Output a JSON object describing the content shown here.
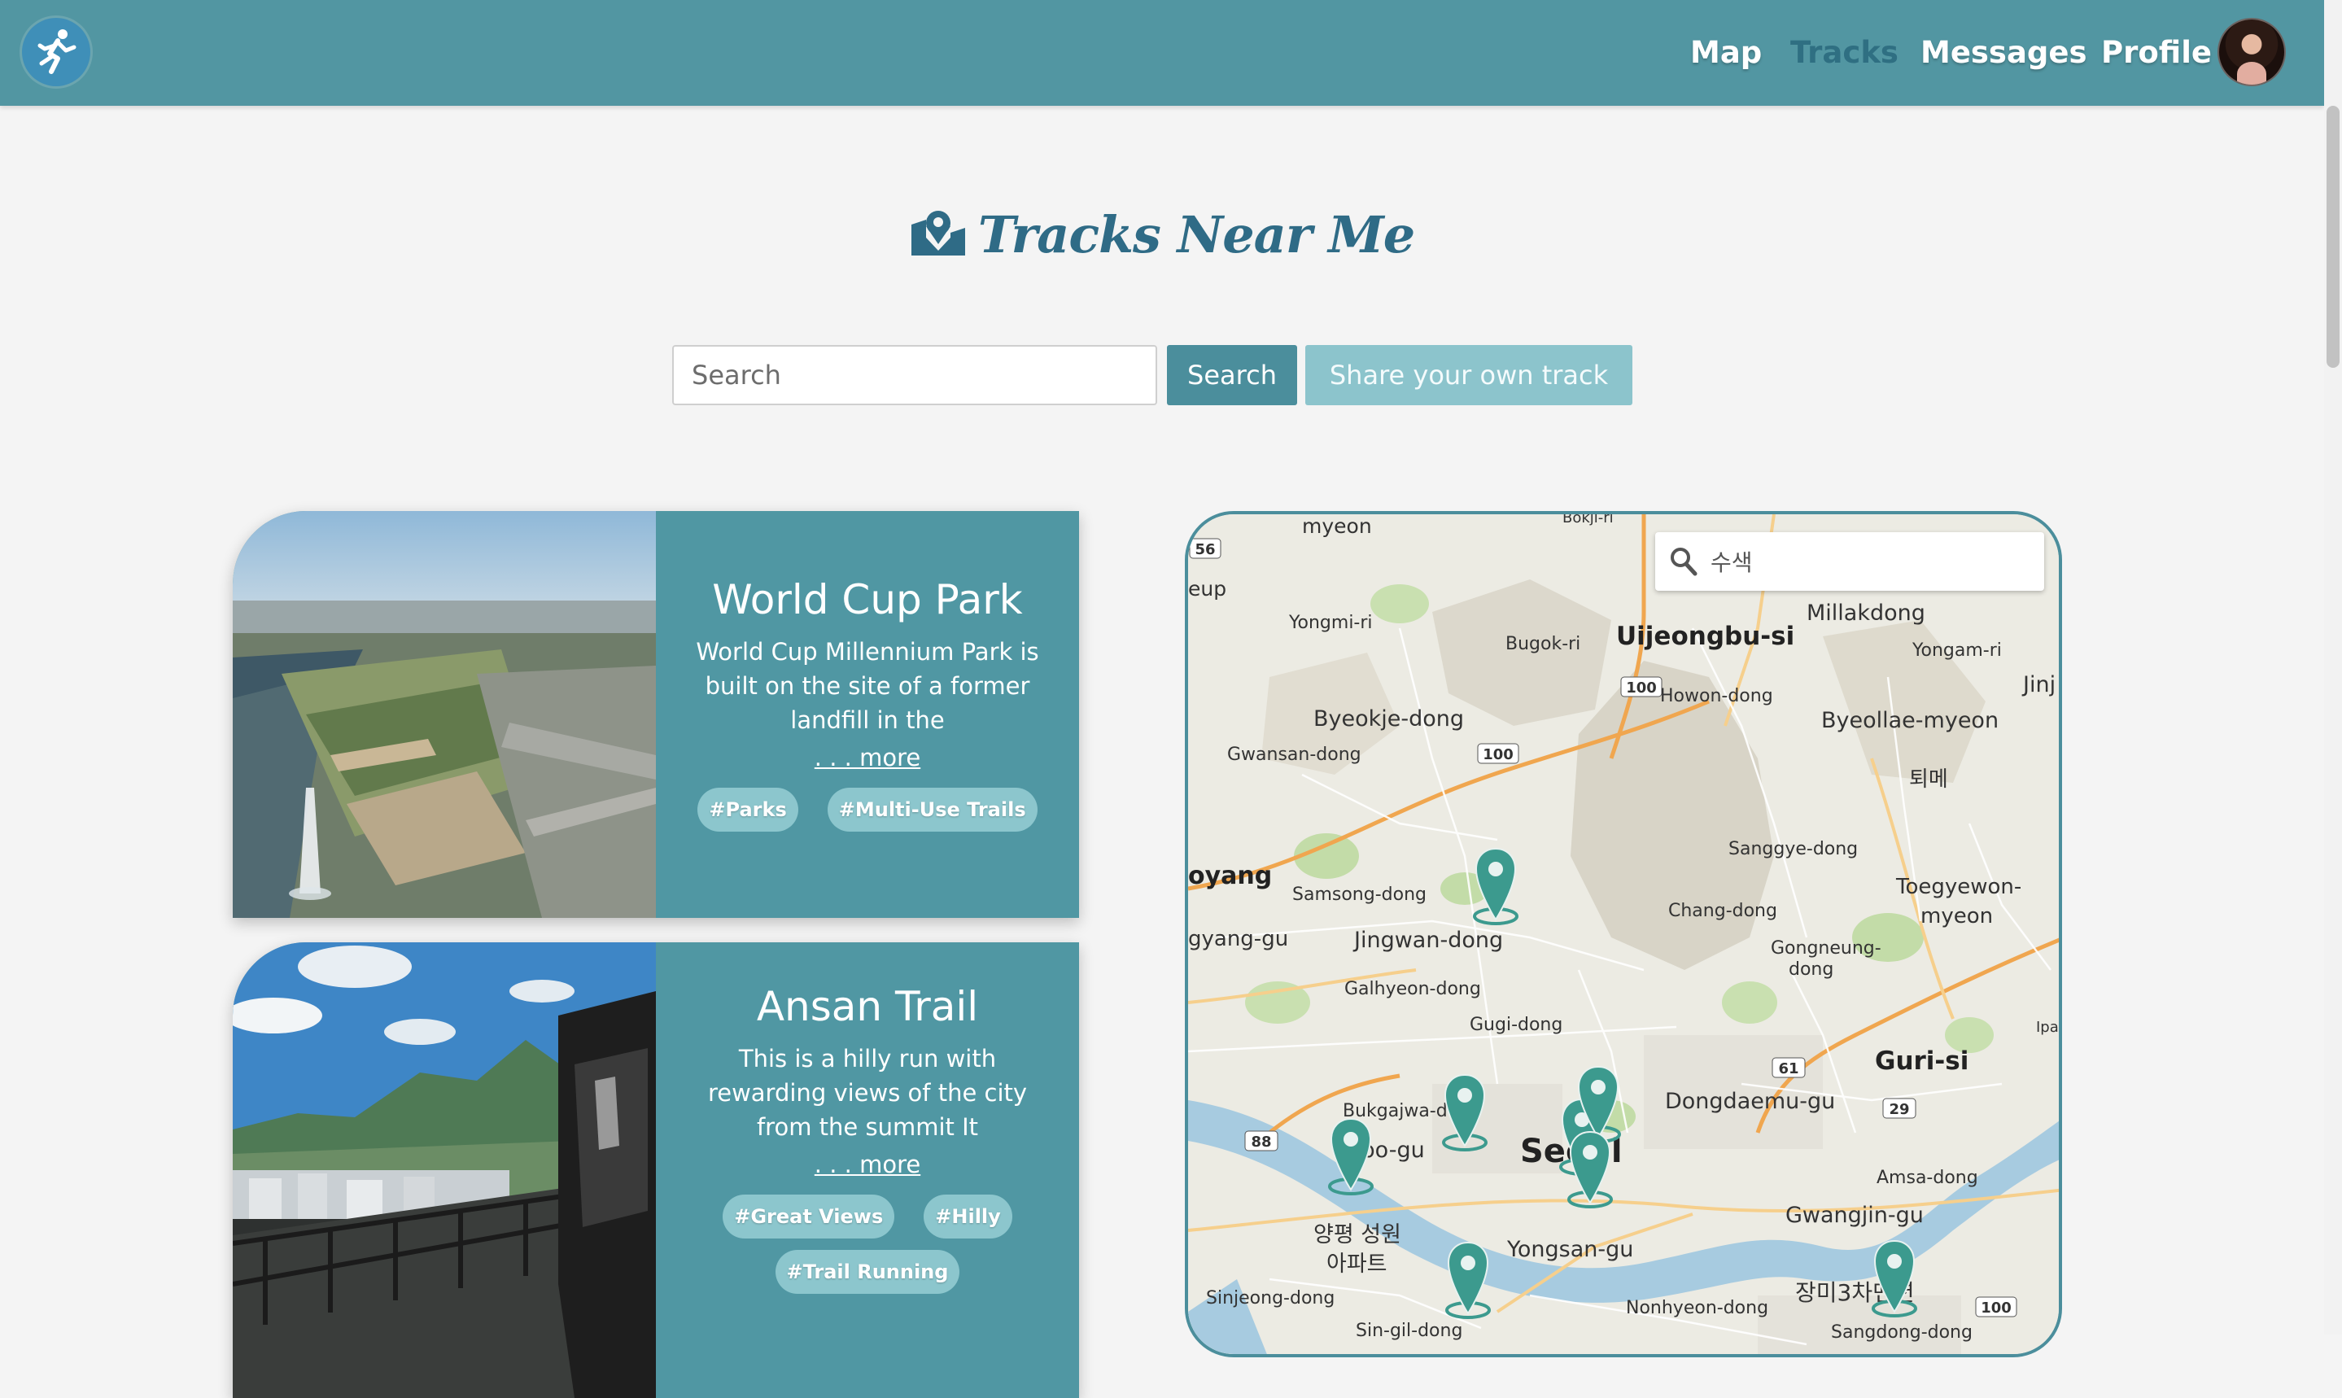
{
  "nav": {
    "links": [
      {
        "label": "Map"
      },
      {
        "label": "Tracks",
        "active": true
      },
      {
        "label": "Messages"
      },
      {
        "label": "Profile"
      }
    ],
    "logo_icon": "runner-icon",
    "avatar_icon": "avatar"
  },
  "header": {
    "title": "Tracks Near Me",
    "title_icon": "map-marker-icon"
  },
  "search": {
    "placeholder": "Search",
    "button_label": "Search",
    "share_label": "Share your own track"
  },
  "tracks": [
    {
      "title": "World Cup Park",
      "description": "World Cup Millennium Park is built on the site of a former landfill in the",
      "more_label": ". . . more",
      "tags": [
        "#Parks",
        "#Multi-Use Trails"
      ]
    },
    {
      "title": "Ansan Trail",
      "description": "This is a hilly run with rewarding views of the city from the summit It",
      "more_label": ". . . more",
      "tags": [
        "#Great Views",
        "#Hilly",
        "#Trail Running"
      ]
    }
  ],
  "map": {
    "search_placeholder": "수색",
    "labels": {
      "myeon": "myeon",
      "eup": "eup",
      "bokji": "Bokji-ri",
      "yongmi": "Yongmi-ri",
      "bugok": "Bugok-ri",
      "uijeongbu": "Uijeongbu-si",
      "millakdong": "Millakdong",
      "yongam": "Yongam-ri",
      "jinj": "Jinj",
      "howon": "Howon-dong",
      "byeokje": "Byeokje-dong",
      "byeollae": "Byeollae-myeon",
      "gwansan": "Gwansan-dong",
      "toeme": "퇴메",
      "sanggye": "Sanggye-dong",
      "goyang": "oyang",
      "samsong": "Samsong-dong",
      "changdong": "Chang-dong",
      "toegyewon": "Toegyewon-",
      "toegyewon2": "myeon",
      "gyanggu": "gyang-gu",
      "jingwan": "Jingwan-dong",
      "gongneung": "Gongneung-",
      "gongneung2": "dong",
      "galhyeon": "Galhyeon-dong",
      "gugi": "Gugi-dong",
      "ipae": "Ipae",
      "guri": "Guri-si",
      "bukgajwa": "Bukgajwa-don",
      "dongdaemun": "Dongdaemu-gu",
      "mapo": "apo-gu",
      "seoul": "Seoul",
      "amsa": "Amsa-dong",
      "yangpyeong": "양평 성원",
      "apateu": "아파트",
      "yongsan": "Yongsan-gu",
      "gwangjin": "Gwangjin-gu",
      "sinjeong": "Sinjeong-dong",
      "nonhyeon": "Nonhyeon-dong",
      "jangmi": "장미3차맨션",
      "sindong": "Sin-gil-dong",
      "sangdong": "Sangdong-dong"
    },
    "road_shields": [
      "56",
      "100",
      "100",
      "88",
      "61",
      "29",
      "100"
    ]
  }
}
